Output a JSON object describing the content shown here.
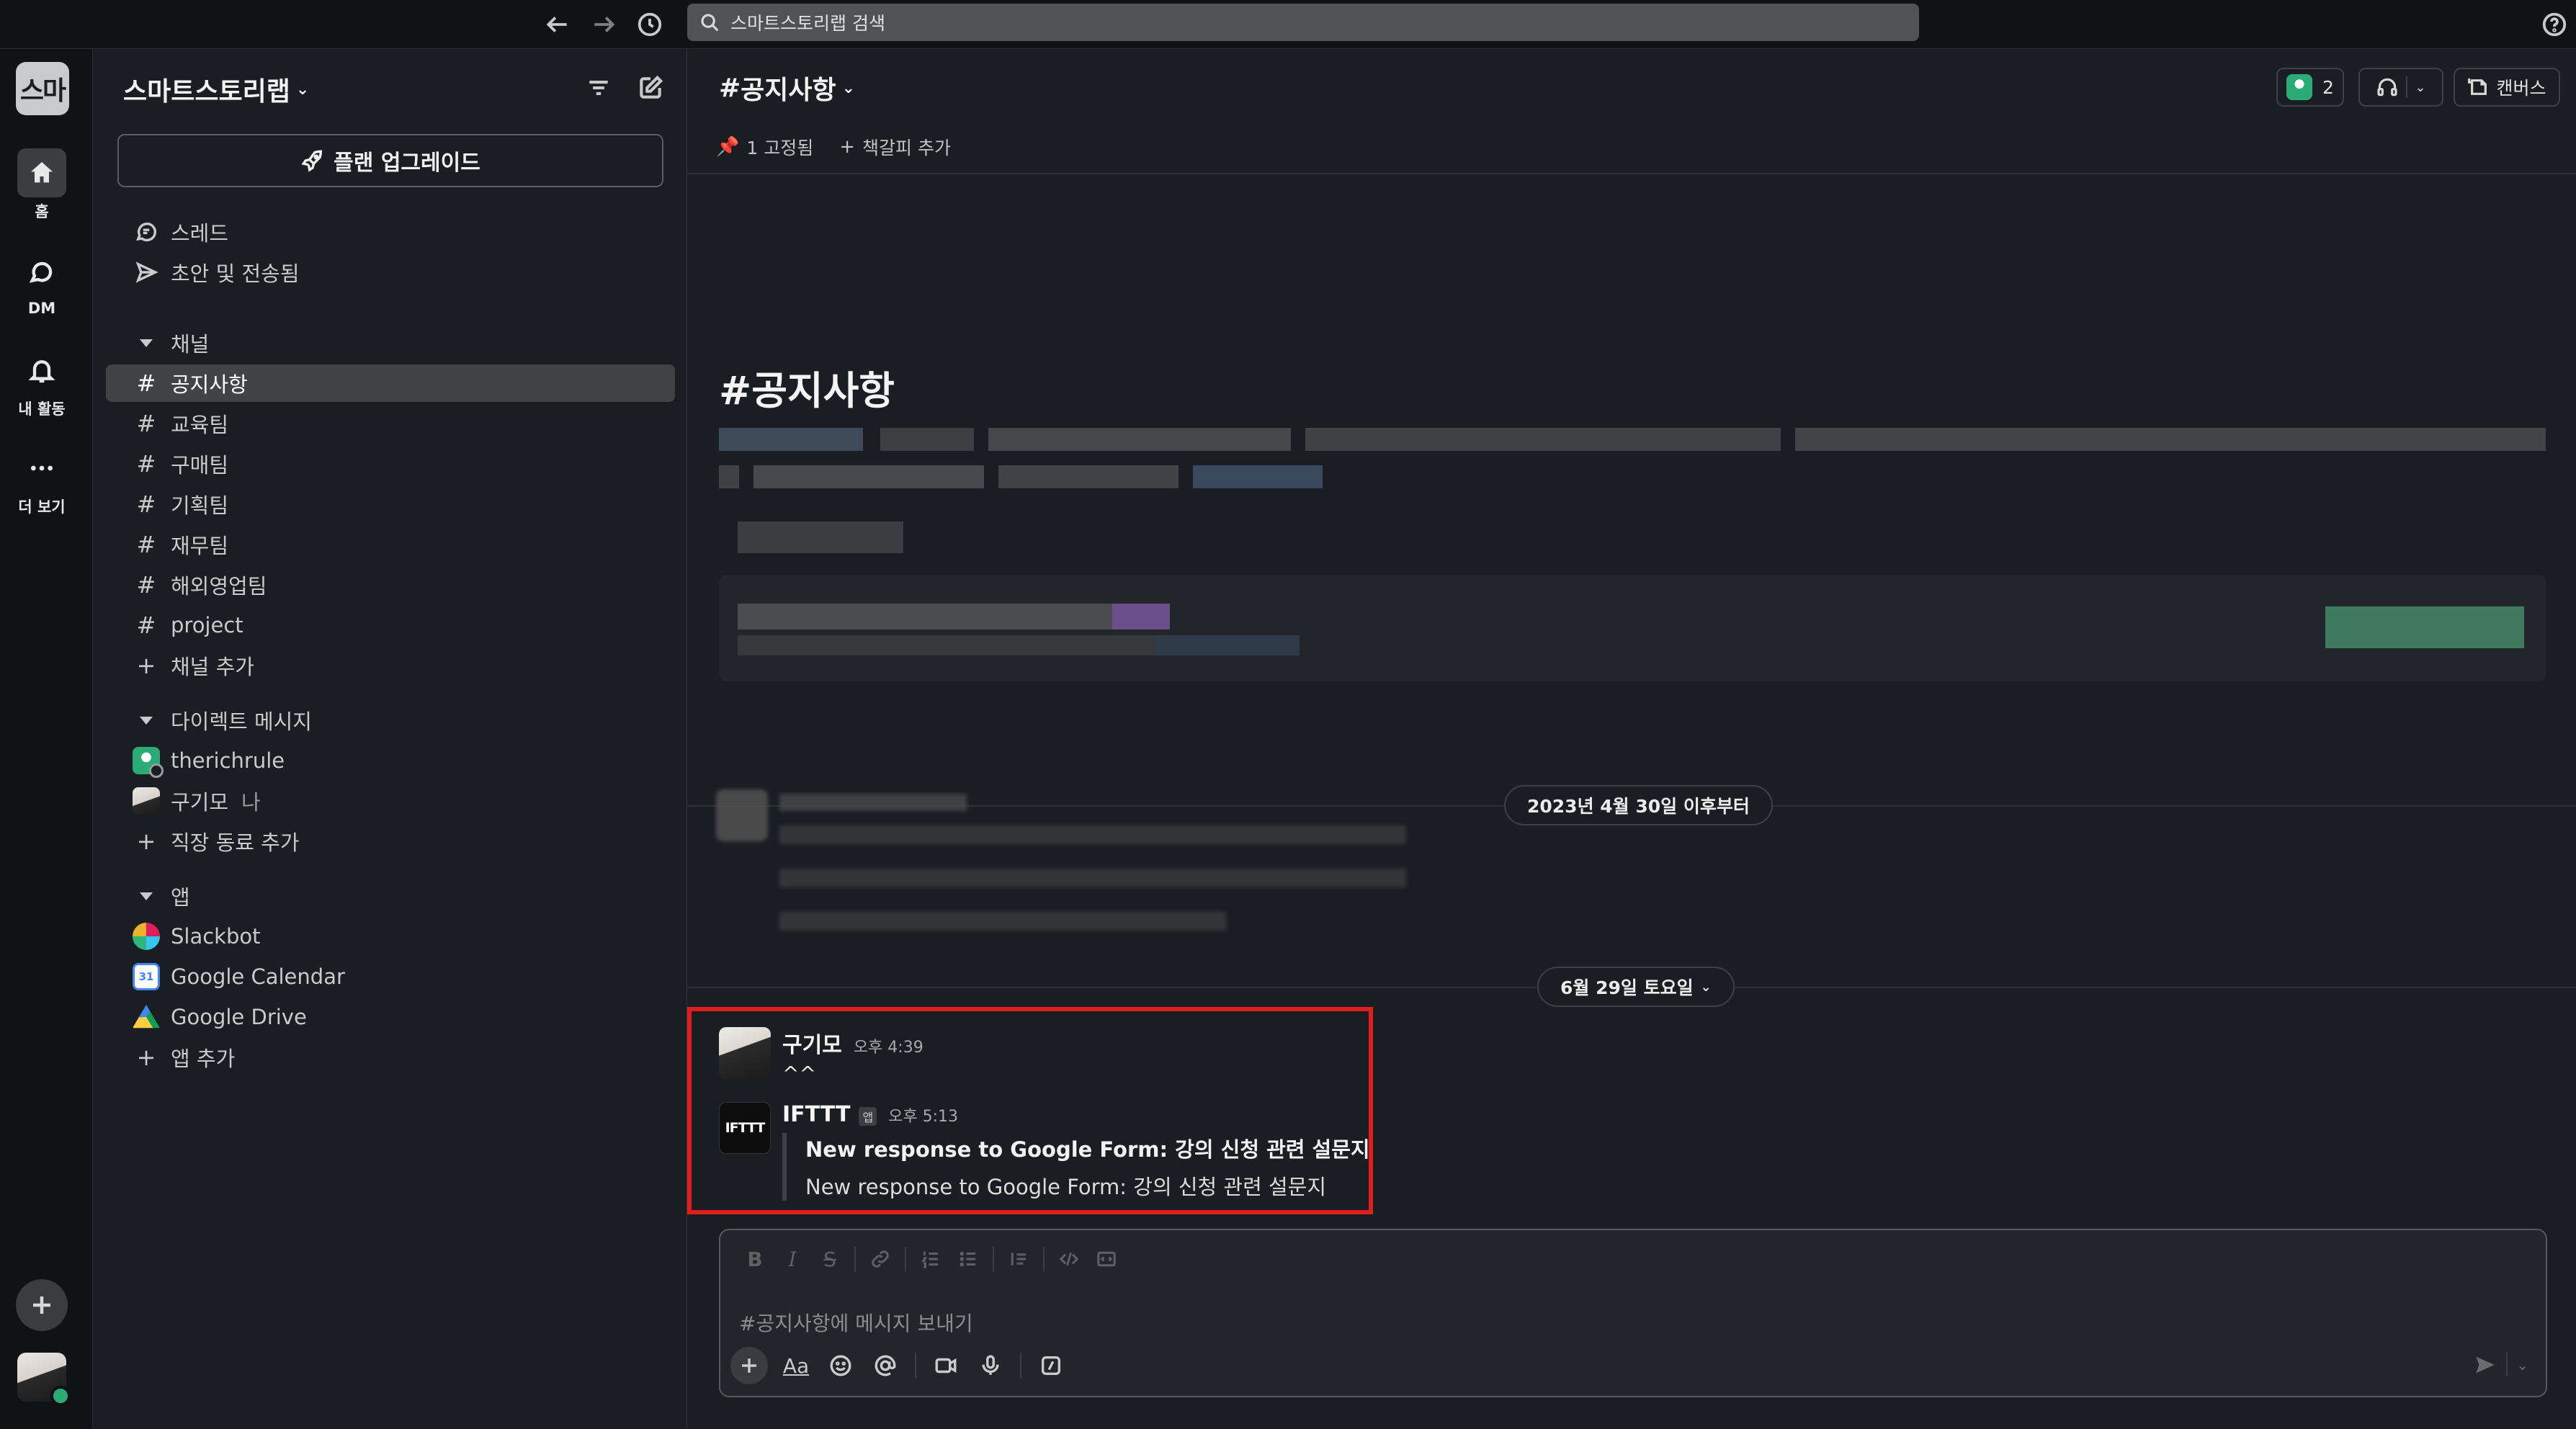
{
  "topbar": {
    "search_placeholder": "스마트스토리랩 검색"
  },
  "rail": {
    "workspace_initials": "스마",
    "items": [
      {
        "label": "홈",
        "icon": "home-icon"
      },
      {
        "label": "DM",
        "icon": "dm-icon"
      },
      {
        "label": "내 활동",
        "icon": "bell-icon"
      },
      {
        "label": "더 보기",
        "icon": "more-icon"
      }
    ]
  },
  "sidebar": {
    "workspace_name": "스마트스토리랩",
    "upgrade_label": "플랜 업그레이드",
    "top_items": [
      {
        "label": "스레드",
        "icon": "threads-icon"
      },
      {
        "label": "초안 및 전송됨",
        "icon": "send-icon"
      }
    ],
    "channels_header": "채널",
    "channels": [
      {
        "name": "공지사항",
        "selected": true
      },
      {
        "name": "교육팀"
      },
      {
        "name": "구매팀"
      },
      {
        "name": "기획팀"
      },
      {
        "name": "재무팀"
      },
      {
        "name": "해외영업팀"
      },
      {
        "name": "project"
      }
    ],
    "add_channel": "채널 추가",
    "dm_header": "다이렉트 메시지",
    "dms": [
      {
        "name": "therichrule"
      },
      {
        "name": "구기모",
        "suffix": "나"
      }
    ],
    "add_coworker": "직장 동료 추가",
    "apps_header": "앱",
    "apps": [
      {
        "name": "Slackbot"
      },
      {
        "name": "Google Calendar",
        "badge": "31"
      },
      {
        "name": "Google Drive"
      }
    ],
    "add_app": "앱 추가"
  },
  "main": {
    "channel_title": "공지사항",
    "member_count": "2",
    "canvas_label": "캔버스",
    "pinned_label": "1 고정됨",
    "add_bookmark": "책갈피 추가",
    "intro_title": "공지사항",
    "date_divider_1": "2023년 4월 30일 이후부터",
    "date_divider_2": "6월 29일 토요일",
    "messages": [
      {
        "author": "구기모",
        "time": "오후 4:39",
        "text": "^^"
      },
      {
        "author": "IFTTT",
        "app_badge": "앱",
        "time": "오후 5:13",
        "avatar_text": "IFTTT",
        "attachment_title": "New response to Google Form: 강의 신청 관련 설문지",
        "attachment_text": "New response to Google Form: 강의 신청 관련 설문지"
      }
    ],
    "composer_placeholder": "#공지사항에 메시지 보내기"
  },
  "colors": {
    "background": "#1a1d21",
    "rail": "#111214",
    "highlight_border": "#e01e1e",
    "online_green": "#2bac76"
  }
}
